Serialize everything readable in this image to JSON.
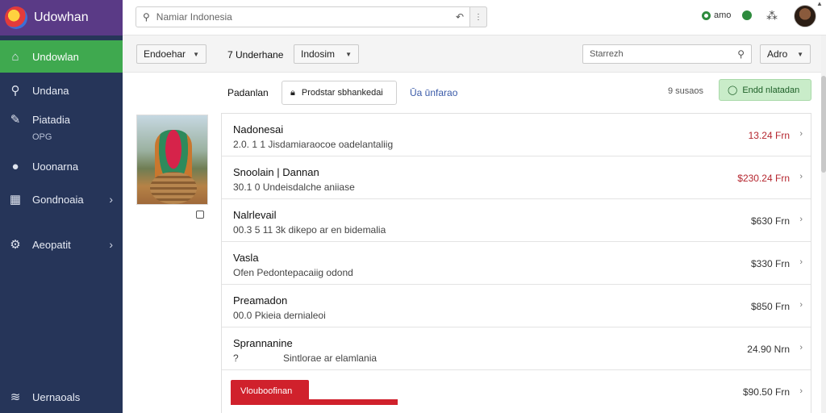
{
  "app": {
    "brand": "Udowhan"
  },
  "sidebar": {
    "items": [
      {
        "label": "Undowlan",
        "icon": "home-icon",
        "active": true
      },
      {
        "label": "Undana",
        "icon": "search-person-icon"
      },
      {
        "label": "Piatadia",
        "sub": "OPG",
        "icon": "wrench-icon"
      },
      {
        "label": "Uoonarna",
        "icon": "chat-icon"
      },
      {
        "label": "Gondnoaia",
        "icon": "grid-icon",
        "chevron": true
      },
      {
        "label": "Aeopatit",
        "icon": "gear-icon",
        "chevron": true
      },
      {
        "label": "Uernaoals",
        "icon": "layers-icon"
      }
    ]
  },
  "topbar": {
    "search_placeholder": "Namiar Indonesia",
    "status_label": "amo"
  },
  "filters": {
    "dropdown1": "Endoehar",
    "label": "7 Underhane",
    "dropdown2": "Indosim",
    "search_placeholder": "Starrezh",
    "dropdown3": "Adro"
  },
  "tabs": {
    "label": "Padanlan",
    "button": "Prodstar sbhankedai",
    "link": "Ūa ūnfarao",
    "count": "9 susaos",
    "green_button": "Endd nlatadan"
  },
  "list": {
    "rows": [
      {
        "title": "Nadonesai",
        "sub": "2.0. 1 1 Jisdamiaraocoe oadelantaliig",
        "price": "13.24 Frn",
        "price_color": "#b5262f"
      },
      {
        "title": "Snoolain | Dannan",
        "sub": "30.1 0 Undeisdalche aniiase",
        "price": "$230.24 Frn",
        "price_color": "#b5262f"
      },
      {
        "title": "Nalrlevail",
        "sub": "00.3 5 11 3k dikepo ar en bidemalia",
        "price": "$630 Frn",
        "price_color": "#333333"
      },
      {
        "title": "Vasla",
        "sub": "Ofen Pedontepacaiig odond",
        "price": "$330 Frn",
        "price_color": "#333333"
      },
      {
        "title": "Preamadon",
        "sub": "00.0 Pkieia dernialeoi",
        "price": "$850 Frn",
        "price_color": "#333333"
      },
      {
        "title": "Sprannanine",
        "sub_prefix": "?",
        "sub": "Sintlorae ar elamlania",
        "price": "24.90 Nrn",
        "price_color": "#333333"
      }
    ],
    "last_row": {
      "button": "Vlouboofinan",
      "price": "$90.50 Frn"
    }
  }
}
